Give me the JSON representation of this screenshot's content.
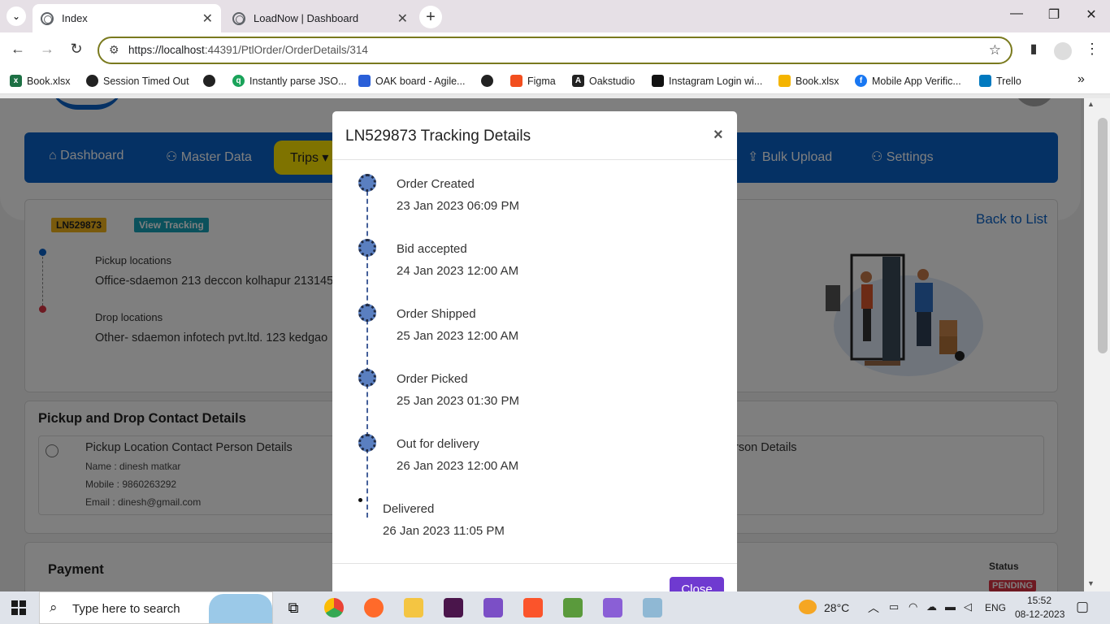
{
  "browser": {
    "tabs": [
      {
        "title": "Index",
        "active": true
      },
      {
        "title": "LoadNow | Dashboard",
        "active": false
      }
    ],
    "url_host": "https://localhost",
    "url_rest": ":44391/PtlOrder/OrderDetails/314",
    "bookmarks": [
      "Book.xlsx",
      "Session Timed Out",
      "Instantly parse JSO...",
      "OAK board - Agile...",
      "Figma",
      "Oakstudio",
      "Instagram Login wi...",
      "Book.xlsx",
      "Mobile App Verific...",
      "Trello"
    ],
    "more_bookmarks": "»"
  },
  "app": {
    "nav": [
      "Dashboard",
      "Master Data",
      "Trips",
      "Bulk Upload",
      "Settings"
    ],
    "order_badge": "LN529873",
    "view_tracking": "View Tracking",
    "back_to_list": "Back to List",
    "pickup_label": "Pickup locations",
    "pickup_value": "Office-sdaemon 213 deccon kolhapur 213145",
    "drop_label": "Drop locations",
    "drop_value": "Other- sdaemon infotech pvt.ltd. 123 kedgao",
    "contact_title": "Pickup and Drop Contact Details",
    "pickup_contact_title": "Pickup Location Contact Person Details",
    "drop_contact_fragment": "rson Details",
    "name_line": "Name : dinesh matkar",
    "mobile_line": "Mobile : 9860263292",
    "email_line": "Email : dinesh@gmail.com",
    "payment_title": "Payment",
    "status_label": "Status",
    "status_value": "PENDING",
    "colors": {
      "nav": "#0a63c9",
      "active_nav": "#ffe600",
      "badge": "#f2b51b",
      "tracking": "#17a2b8",
      "pending": "#dc3545"
    }
  },
  "modal": {
    "title": "LN529873 Tracking Details",
    "close_x": "×",
    "events": [
      {
        "status": "Order Created",
        "date": "23 Jan 2023 06:09 PM"
      },
      {
        "status": "Bid accepted",
        "date": "24 Jan 2023 12:00 AM"
      },
      {
        "status": "Order Shipped",
        "date": "25 Jan 2023 12:00 AM"
      },
      {
        "status": "Order Picked",
        "date": "25 Jan 2023 01:30 PM"
      },
      {
        "status": "Out for delivery",
        "date": "26 Jan 2023 12:00 AM"
      },
      {
        "status": "Delivered",
        "date": "26 Jan 2023 11:05 PM"
      }
    ],
    "close_button": "Close"
  },
  "taskbar": {
    "search_placeholder": "Type here to search",
    "temperature": "28°C",
    "language": "ENG",
    "time": "15:52",
    "date": "08-12-2023"
  }
}
